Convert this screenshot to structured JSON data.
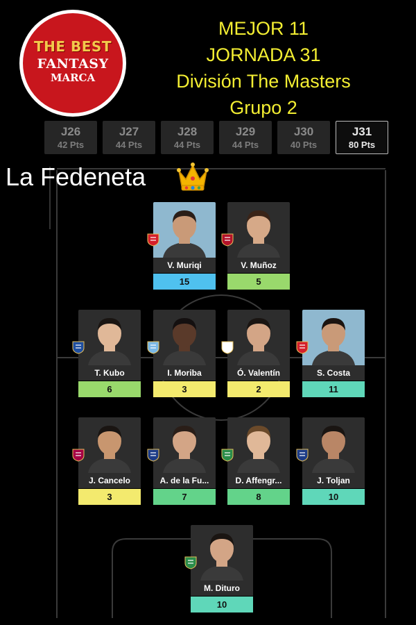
{
  "logo": {
    "line1": "THE BEST",
    "line2": "FANTASY",
    "line3": "MARCA"
  },
  "titles": [
    "MEJOR 11",
    "JORNADA 31",
    "División The Masters",
    "Grupo 2"
  ],
  "tabs": [
    {
      "label": "J26",
      "pts": "42 Pts"
    },
    {
      "label": "J27",
      "pts": "44 Pts"
    },
    {
      "label": "J28",
      "pts": "44 Pts"
    },
    {
      "label": "J29",
      "pts": "44 Pts"
    },
    {
      "label": "J30",
      "pts": "40 Pts"
    },
    {
      "label": "J31",
      "pts": "80 Pts",
      "active": true
    }
  ],
  "team": {
    "name": "La Fedeneta"
  },
  "colors": {
    "green": "#99d96c",
    "yellow": "#f3ea6e",
    "teal": "#5fd7b9",
    "blue": "#4fc1ef",
    "lightgreen": "#63d38a"
  },
  "players": [
    {
      "name": "V. Muriqi",
      "points": "15",
      "color": "#4fc1ef",
      "photo": "blue",
      "club": "mallorca-crest-icon",
      "clubColor": "#d4202b",
      "skin": "#c99a78",
      "hair": "#2a1e18"
    },
    {
      "name": "V. Muñoz",
      "points": "5",
      "color": "#99d96c",
      "photo": "dark",
      "club": "osasuna-crest-icon",
      "clubColor": "#b3122a",
      "skin": "#d6a988",
      "hair": "#3a2418"
    },
    {
      "name": "T. Kubo",
      "points": "6",
      "color": "#99d96c",
      "photo": "dark",
      "club": "real-sociedad-crest-icon",
      "clubColor": "#1f4fa0",
      "skin": "#e0b898",
      "hair": "#1a1512"
    },
    {
      "name": "I. Moriba",
      "points": "3",
      "color": "#f3ea6e",
      "photo": "dark",
      "club": "celta-crest-icon",
      "clubColor": "#7ab8e6",
      "skin": "#5a3a2a",
      "hair": "#141010"
    },
    {
      "name": "Ó. Valentín",
      "points": "2",
      "color": "#f3ea6e",
      "photo": "dark",
      "club": "rayo-vallecano-crest-icon",
      "clubColor": "#ffffff",
      "skin": "#d3a586",
      "hair": "#1a1512"
    },
    {
      "name": "S. Costa",
      "points": "11",
      "color": "#5fd7b9",
      "photo": "blue",
      "club": "mallorca-crest-icon",
      "clubColor": "#d4202b",
      "skin": "#c99a78",
      "hair": "#1c1410"
    },
    {
      "name": "J. Cancelo",
      "points": "3",
      "color": "#f3ea6e",
      "photo": "dark",
      "club": "barcelona-crest-icon",
      "clubColor": "#a50044",
      "skin": "#c8966f",
      "hair": "#1a1512"
    },
    {
      "name": "A. de la Fu...",
      "points": "7",
      "color": "#63d38a",
      "photo": "dark",
      "club": "levante-crest-icon",
      "clubColor": "#1d3c87",
      "skin": "#d3a586",
      "hair": "#2a1e18"
    },
    {
      "name": "D. Affengr...",
      "points": "8",
      "color": "#63d38a",
      "photo": "dark",
      "club": "elche-crest-icon",
      "clubColor": "#2a8c4a",
      "skin": "#e0b898",
      "hair": "#6b4a2a"
    },
    {
      "name": "J. Toljan",
      "points": "10",
      "color": "#5fd7b9",
      "photo": "dark",
      "club": "levante-crest-icon",
      "clubColor": "#1d3c87",
      "skin": "#b98666",
      "hair": "#1a1512"
    },
    {
      "name": "M. Dituro",
      "points": "10",
      "color": "#5fd7b9",
      "photo": "dark",
      "club": "elche-crest-icon",
      "clubColor": "#2a8c4a",
      "skin": "#d3a586",
      "hair": "#1a1512"
    }
  ]
}
